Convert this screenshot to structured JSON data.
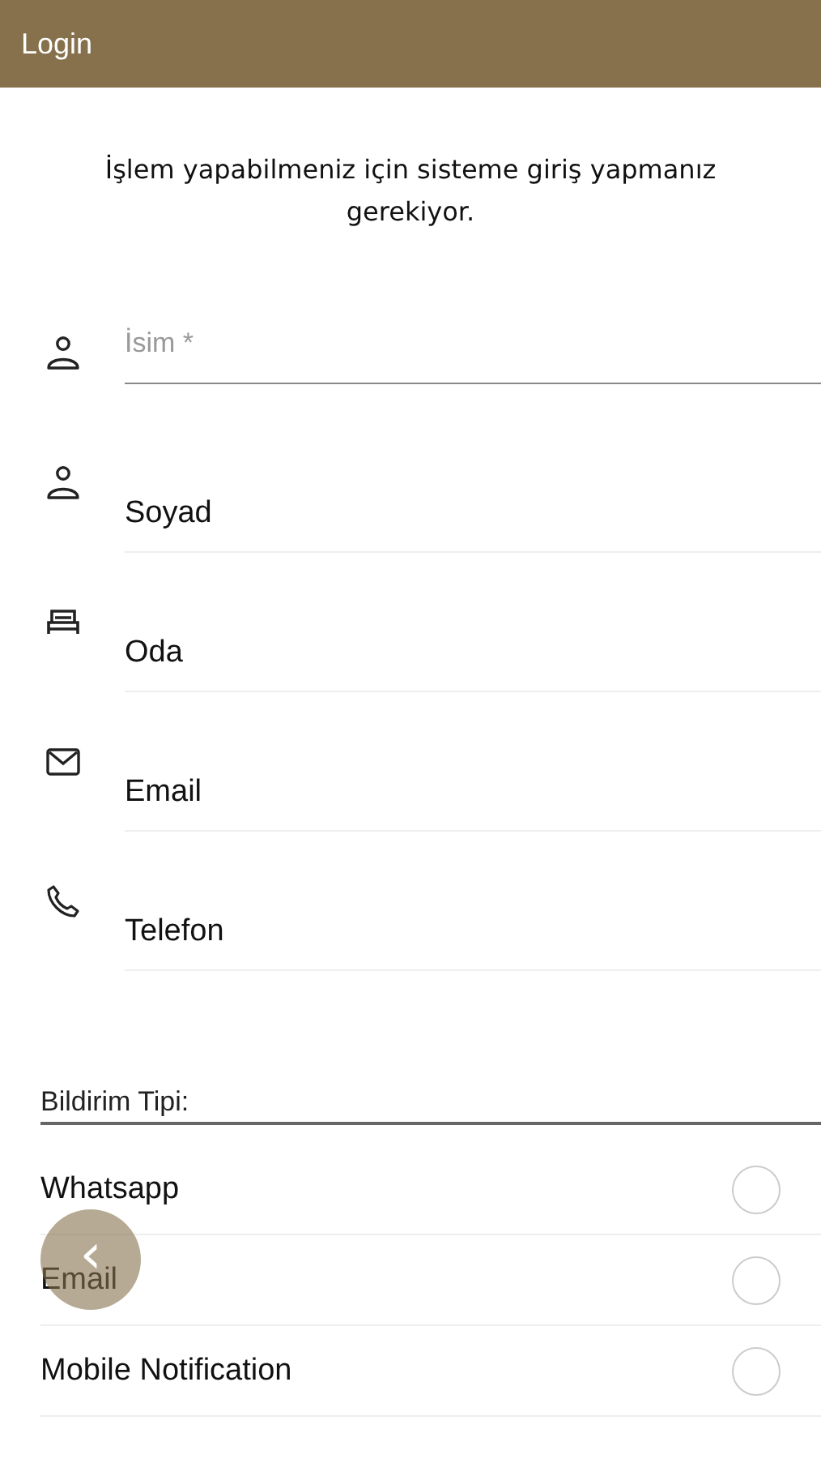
{
  "header": {
    "title": "Login"
  },
  "message": "İşlem yapabilmeniz için sisteme giriş yapmanız gerekiyor.",
  "fields": [
    {
      "placeholder": "İsim *",
      "focused": true
    },
    {
      "value": "Soyad",
      "focused": false
    },
    {
      "value": "Oda",
      "focused": false
    },
    {
      "value": "Email",
      "focused": false
    },
    {
      "value": "Telefon",
      "focused": false
    }
  ],
  "notification": {
    "label": "Bildirim Tipi:",
    "options": [
      {
        "label": "Whatsapp",
        "selected": false
      },
      {
        "label": "Email",
        "selected": false
      },
      {
        "label": "Mobile Notification",
        "selected": false
      }
    ]
  },
  "back_button": {
    "label": "‹"
  }
}
